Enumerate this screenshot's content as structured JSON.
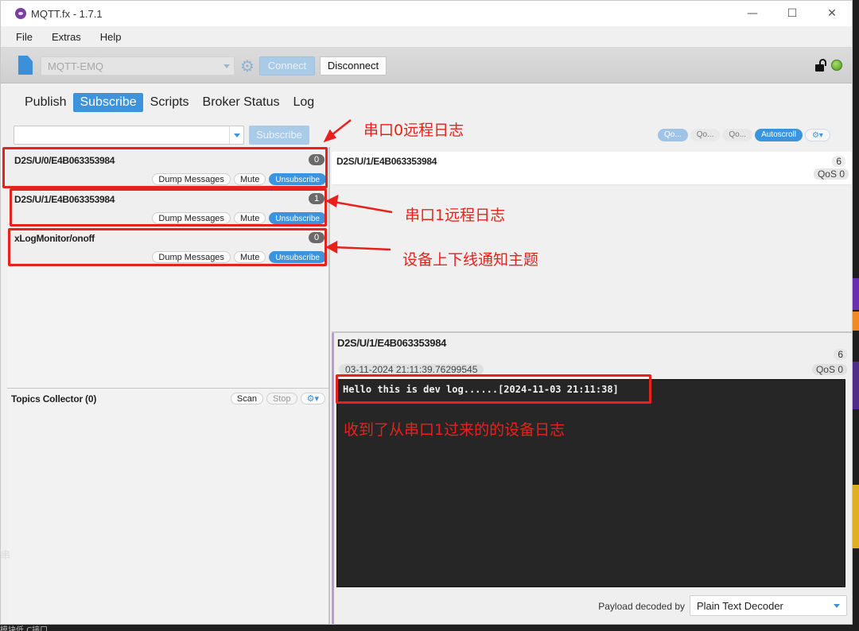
{
  "window": {
    "title": "MQTT.fx - 1.7.1",
    "controls": {
      "minimize": "—",
      "maximize": "☐",
      "close": "✕"
    }
  },
  "menu": [
    "File",
    "Extras",
    "Help"
  ],
  "connection": {
    "profile": "MQTT-EMQ",
    "connect_label": "Connect",
    "disconnect_label": "Disconnect",
    "status_color": "#5fb32a"
  },
  "tabs": [
    {
      "label": "Publish",
      "active": false
    },
    {
      "label": "Subscribe",
      "active": true
    },
    {
      "label": "Scripts",
      "active": false
    },
    {
      "label": "Broker Status",
      "active": false
    },
    {
      "label": "Log",
      "active": false
    }
  ],
  "subscribe": {
    "topic_value": "",
    "button_label": "Subscribe",
    "qos_buttons": [
      "Qo...",
      "Qo...",
      "Qo..."
    ],
    "autoscroll_label": "Autoscroll",
    "gear_label": "⚙▾"
  },
  "subscriptions": [
    {
      "topic": "D2S/U/0/E4B063353984",
      "count": "0",
      "dump": "Dump Messages",
      "mute": "Mute",
      "unsubscribe": "Unsubscribe"
    },
    {
      "topic": "D2S/U/1/E4B063353984",
      "count": "1",
      "dump": "Dump Messages",
      "mute": "Mute",
      "unsubscribe": "Unsubscribe"
    },
    {
      "topic": "xLogMonitor/onoff",
      "count": "0",
      "dump": "Dump Messages",
      "mute": "Mute",
      "unsubscribe": "Unsubscribe"
    }
  ],
  "topics_collector": {
    "title": "Topics Collector (0)",
    "scan_label": "Scan",
    "stop_label": "Stop",
    "gear_label": "⚙▾"
  },
  "message_list": [
    {
      "topic": "D2S/U/1/E4B063353984",
      "count": "6",
      "qos": "QoS 0"
    }
  ],
  "message_detail": {
    "topic": "D2S/U/1/E4B063353984",
    "count": "6",
    "timestamp": "03-11-2024  21:11:39.76299545",
    "qos": "QoS 0",
    "payload": "Hello this is dev log......[2024-11-03 21:11:38]",
    "decoder_label": "Payload decoded by",
    "decoder_value": "Plain Text Decoder"
  },
  "annotations": {
    "serial0": "串口0远程日志",
    "serial1": "串口1远程日志",
    "device_topic": "设备上下线通知主题",
    "received": "收到了从串口1过来的的设备日志",
    "color": "#e7211b"
  },
  "desktop": {
    "bottom_text": "模块低  C接口",
    "left_edge_char": "串"
  }
}
